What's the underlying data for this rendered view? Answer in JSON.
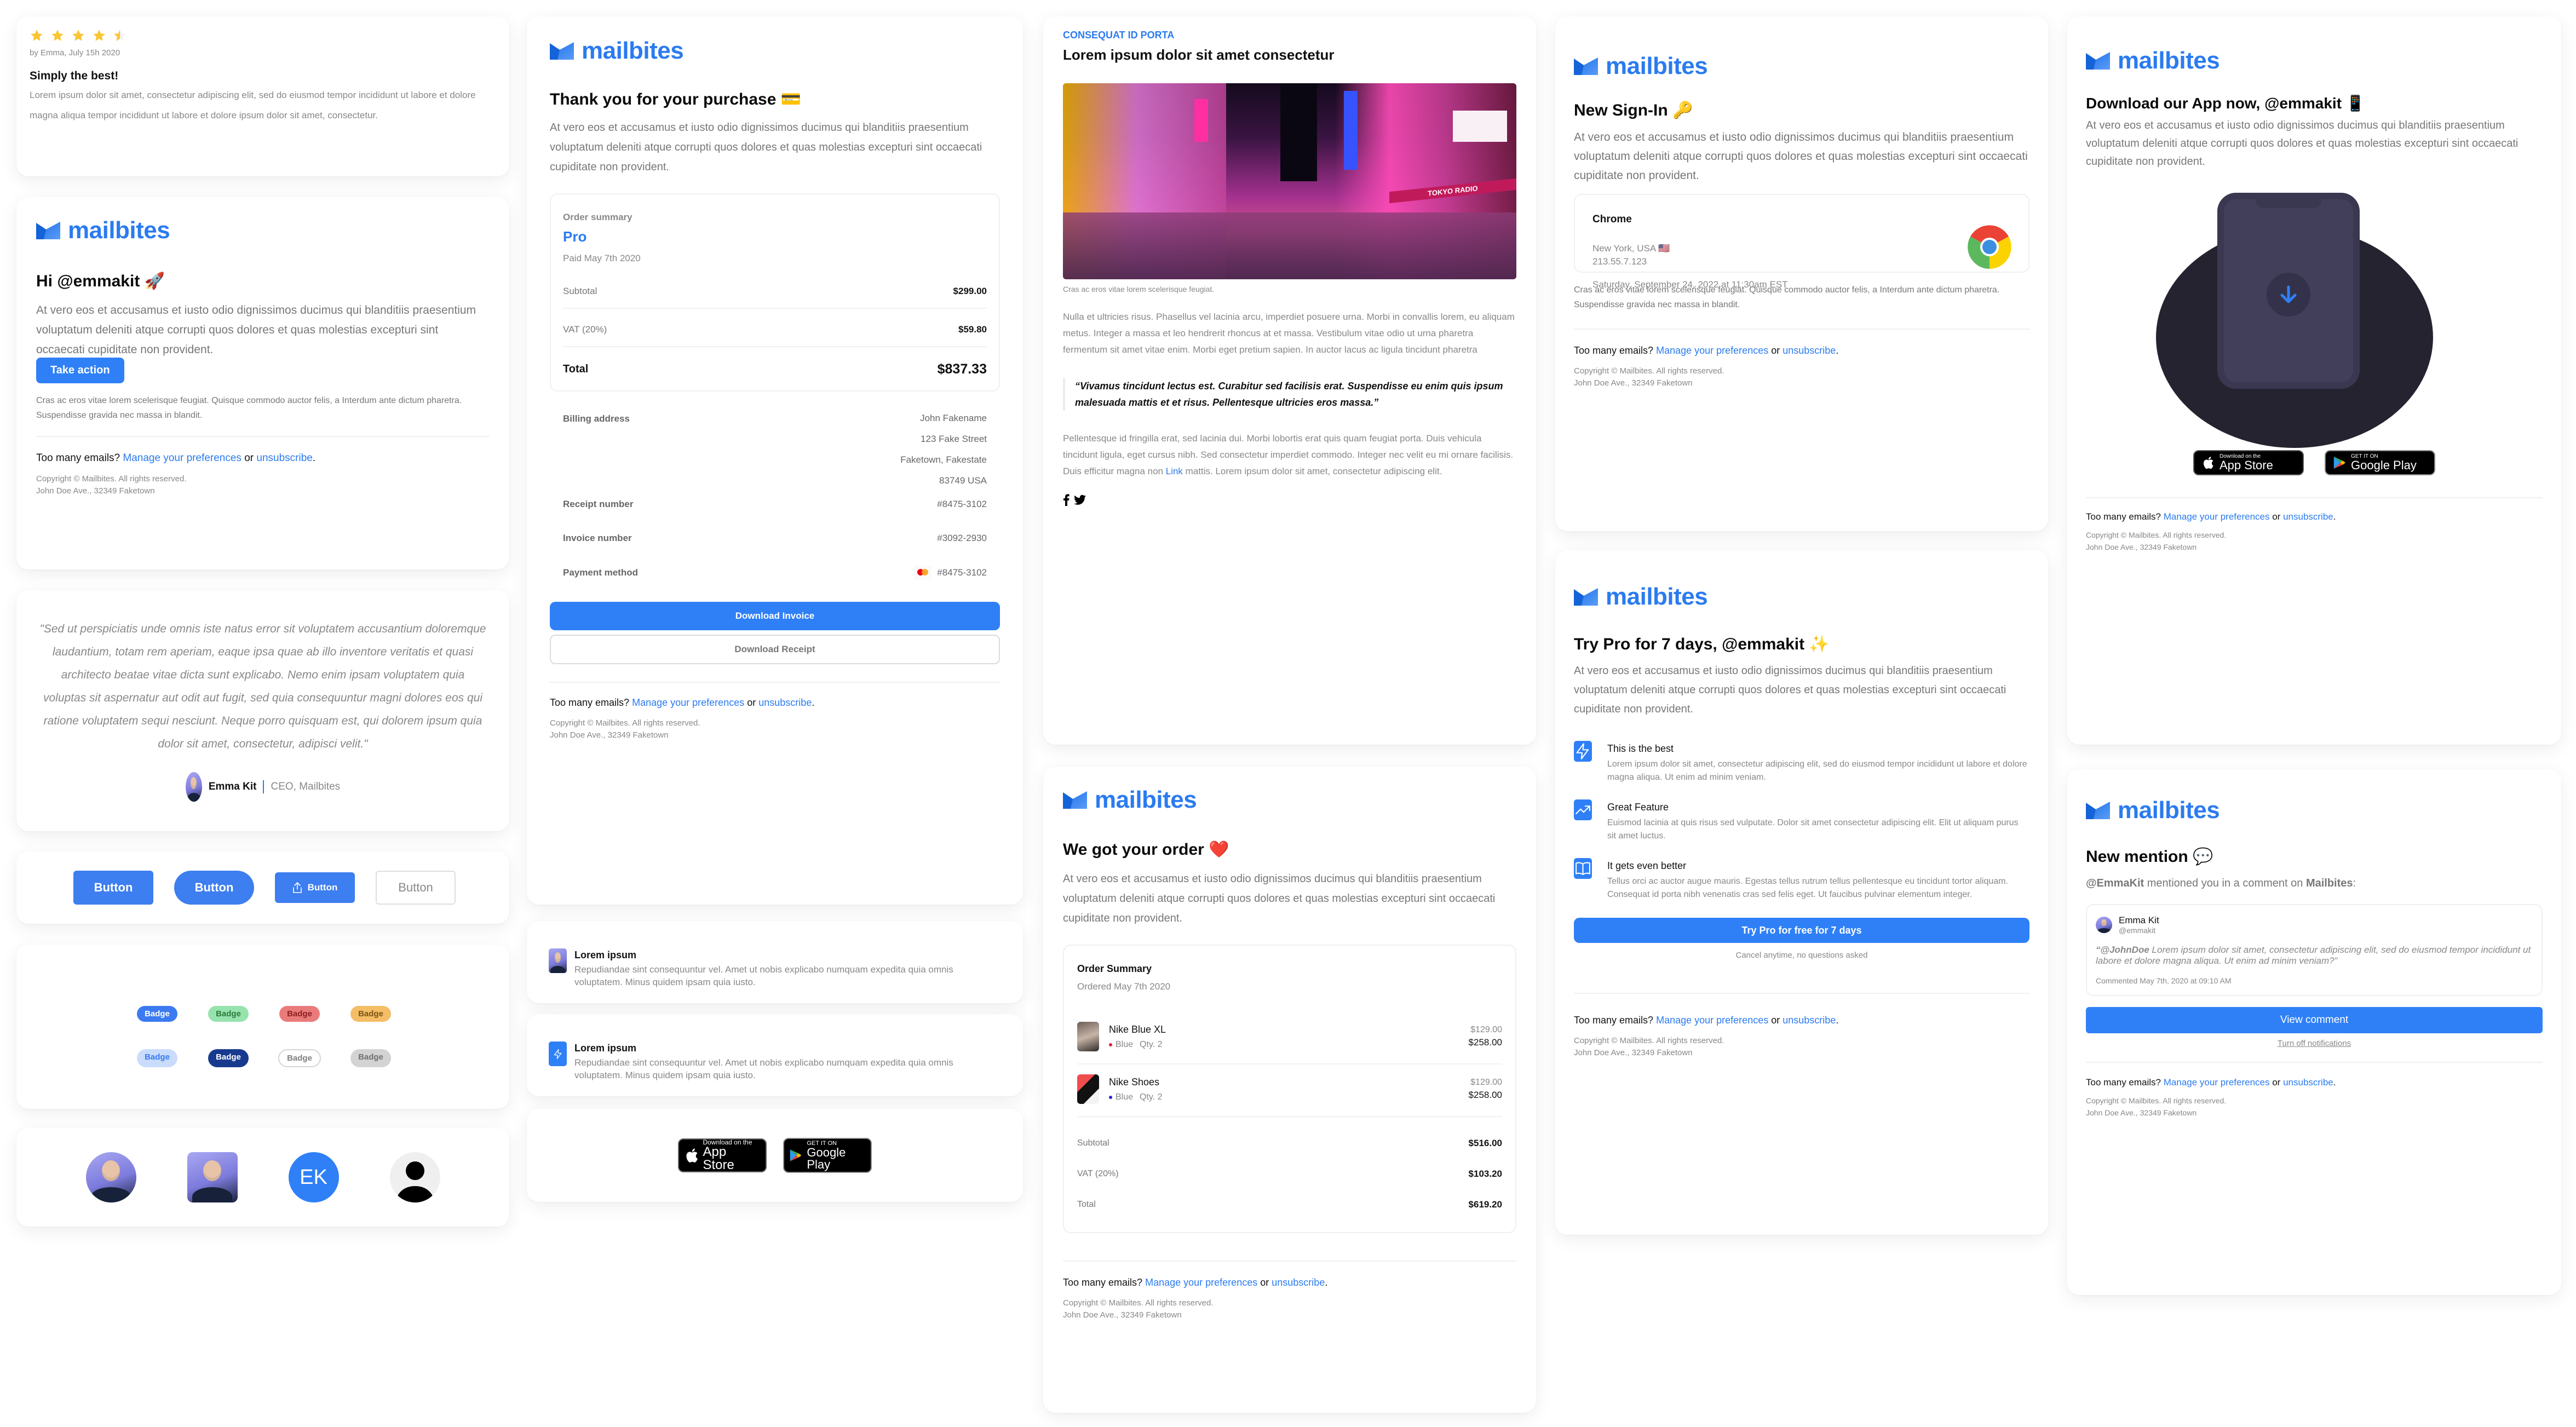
{
  "brand": {
    "name": "mailbites",
    "color": "#2b7bf0"
  },
  "footer": {
    "prefix": "Too many emails?",
    "manage": "Manage your preferences",
    "or": "or",
    "unsubscribe": "unsubscribe",
    "period": ".",
    "copyright": "Copyright © Mailbites. All rights reserved.",
    "address": "John Doe Ave., 32349 Faketown"
  },
  "review": {
    "rating": 4.5,
    "rating_max": 5,
    "byline": "by Emma, July 15h 2020",
    "title": "Simply the best!",
    "body": "Lorem ipsum dolor sit amet, consectetur adipiscing elit, sed do eiusmod tempor incididunt ut labore et dolore magna aliqua tempor incididunt ut labore et dolore ipsum dolor sit amet, consectetur."
  },
  "welcome": {
    "title": "Hi @emmakit 🚀",
    "lead": "At vero eos et accusamus et iusto odio dignissimos ducimus qui blanditiis praesentium voluptatum deleniti atque corrupti quos dolores et quas molestias excepturi sint occaecati cupiditate non provident.",
    "cta": "Take action",
    "note": "Cras ac eros vitae lorem scelerisque feugiat. Quisque commodo auctor felis, a Interdum ante dictum pharetra. Suspendisse gravida nec massa in blandit."
  },
  "testimonial": {
    "quote": "\"Sed ut perspiciatis unde omnis iste natus error sit voluptatem accusantium doloremque laudantium, totam rem aperiam, eaque ipsa quae ab illo inventore veritatis et quasi architecto beatae vitae dicta sunt explicabo. Nemo enim ipsam voluptatem quia voluptas sit aspernatur aut odit aut fugit, sed quia consequuntur magni dolores eos qui ratione voluptatem sequi nesciunt. Neque porro quisquam est, qui dolorem ipsum quia dolor sit amet, consectetur, adipisci velit.\"",
    "name": "Emma Kit",
    "role": "CEO, Mailbites"
  },
  "buttons": {
    "items": [
      {
        "label": "Button",
        "style": "square"
      },
      {
        "label": "Button",
        "style": "pill"
      },
      {
        "label": "Button",
        "style": "icon",
        "icon": "share-icon"
      },
      {
        "label": "Button",
        "style": "outline"
      }
    ]
  },
  "badges": {
    "items": [
      {
        "label": "Badge",
        "bg": "#3b7af0",
        "fg": "#ffffff"
      },
      {
        "label": "Badge",
        "bg": "#97e3ad",
        "fg": "#2a7a3e"
      },
      {
        "label": "Badge",
        "bg": "#ea7b7b",
        "fg": "#8b1f1f"
      },
      {
        "label": "Badge",
        "bg": "#f4bd66",
        "fg": "#7a5516"
      },
      {
        "label": "Badge",
        "bg": "#c9dcfb",
        "fg": "#3b7af0"
      },
      {
        "label": "Badge",
        "bg": "#173a8f",
        "fg": "#ffffff"
      },
      {
        "label": "Badge",
        "bg": "#ffffff",
        "fg": "#808080",
        "border": "#d6d6d6"
      },
      {
        "label": "Badge",
        "bg": "#d3d3d3",
        "fg": "#707070"
      }
    ]
  },
  "avatars": {
    "initials": "EK"
  },
  "purchase": {
    "title": "Thank you for your purchase 💳",
    "lead": "At vero eos et accusamus et iusto odio dignissimos ducimus qui blanditiis praesentium voluptatum deleniti atque corrupti quos dolores et quas molestias excepturi sint occaecati cupiditate non provident.",
    "summary_label": "Order summary",
    "plan": "Pro",
    "paid": "Paid May 7th 2020",
    "lines": [
      {
        "label": "Subtotal",
        "value": "$299.00"
      },
      {
        "label": "VAT (20%)",
        "value": "$59.80"
      }
    ],
    "total_label": "Total",
    "total_value": "$837.33",
    "billing_label": "Billing address",
    "billing_lines": [
      "John Fakename",
      "123 Fake Street",
      "Faketown, Fakestate",
      "83749 USA"
    ],
    "receipt_label": "Receipt number",
    "receipt_value": "#8475-3102",
    "invoice_label": "Invoice number",
    "invoice_value": "#3092-2930",
    "payment_label": "Payment method",
    "payment_value": "#8475-3102",
    "download_invoice": "Download Invoice",
    "download_receipt": "Download Receipt"
  },
  "list_items": [
    {
      "title": "Lorem ipsum",
      "body": "Repudiandae sint consequuntur vel. Amet ut nobis explicabo numquam expedita quia omnis voluptatem. Minus quidem ipsam quia iusto.",
      "media": "avatar"
    },
    {
      "title": "Lorem ipsum",
      "body": "Repudiandae sint consequuntur vel. Amet ut nobis explicabo numquam expedita quia omnis voluptatem. Minus quidem ipsam quia iusto.",
      "media": "lightning-icon"
    }
  ],
  "stores": {
    "apple_small": "Download on the",
    "apple_big": "App Store",
    "google_small": "GET IT ON",
    "google_big": "Google Play"
  },
  "article": {
    "eyebrow": "CONSEQUAT ID PORTA",
    "title": "Lorem ipsum dolor sit amet consectetur",
    "caption": "Cras ac eros vitae lorem scelerisque feugiat.",
    "p1": "Nulla et ultricies risus. Phasellus vel lacinia arcu, imperdiet posuere urna. Morbi in convallis lorem, eu aliquam metus. Integer a massa et leo hendrerit rhoncus at et massa. Vestibulum vitae odio ut urna pharetra fermentum sit amet vitae enim. Morbi eget pretium sapien. In auctor lacus ac ligula tincidunt pharetra",
    "quote": "“Vivamus tincidunt lectus est. Curabitur sed facilisis erat. Suspendisse eu enim quis ipsum malesuada mattis et et risus. Pellentesque ultricies eros massa.”",
    "p2_before": "Pellentesque id fringilla erat, sed lacinia dui. Morbi lobortis erat quis quam feugiat porta. Duis vehicula tincidunt ligula, eget cursus nibh. Sed consectetur imperdiet commodo. Integer nec velit eu mi ornare facilisis. Duis efficitur magna non",
    "p2_link": "Link",
    "p2_after": "mattis. Lorem ipsum dolor sit amet, consectetur adipiscing elit.",
    "image_sign": "TOKYO RADIO"
  },
  "order": {
    "title": "We got your order ❤️",
    "lead": "At vero eos et accusamus et iusto odio dignissimos ducimus qui blanditiis praesentium voluptatum deleniti atque corrupti quos dolores et quas molestias excepturi sint occaecati cupiditate non provident.",
    "summary_title": "Order Summary",
    "ordered": "Ordered May 7th 2020",
    "items": [
      {
        "name": "Nike Blue XL",
        "color_label": "Blue",
        "dot": "#e0202e",
        "qty": "Qty. 2",
        "unit": "$129.00",
        "total": "$258.00"
      },
      {
        "name": "Nike Shoes",
        "color_label": "Blue",
        "dot": "#2a1ee0",
        "qty": "Qty. 2",
        "unit": "$129.00",
        "total": "$258.00"
      }
    ],
    "lines": [
      {
        "label": "Subtotal",
        "value": "$516.00"
      },
      {
        "label": "VAT (20%)",
        "value": "$103.20"
      },
      {
        "label": "Total",
        "value": "$619.20"
      }
    ]
  },
  "signin": {
    "title": "New Sign-In 🔑",
    "lead": "At vero eos et accusamus et iusto odio dignissimos ducimus qui blanditiis praesentium voluptatum deleniti atque corrupti quos dolores et quas molestias excepturi sint occaecati cupiditate non provident.",
    "browser": "Chrome",
    "location": "New York, USA 🇺🇸",
    "ip": "213.55.7.123",
    "datetime": "Saturday, September 24, 2022 at 11:30am EST",
    "note": "Cras ac eros vitae lorem scelerisque feugiat. Quisque commodo auctor felis, a Interdum ante dictum pharetra. Suspendisse gravida nec massa in blandit."
  },
  "trial": {
    "title": "Try Pro for 7 days, @emmakit ✨",
    "lead": "At vero eos et accusamus et iusto odio dignissimos ducimus qui blanditiis praesentium voluptatum deleniti atque corrupti quos dolores et quas molestias excepturi sint occaecati cupiditate non provident.",
    "features": [
      {
        "icon": "lightning-icon",
        "title": "This is the best",
        "body": "Lorem ipsum dolor sit amet, consectetur adipiscing elit, sed do eiusmod tempor incididunt ut labore et dolore magna aliqua. Ut enim ad minim veniam."
      },
      {
        "icon": "trending-up-icon",
        "title": "Great Feature",
        "body": "Euismod lacinia at quis risus sed vulputate. Dolor sit amet consectetur adipiscing elit. Elit ut aliquam purus sit amet luctus."
      },
      {
        "icon": "book-icon",
        "title": "It gets even better",
        "body": "Tellus orci ac auctor augue mauris. Egestas tellus rutrum tellus pellentesque eu tincidunt tortor aliquam. Consequat id porta nibh venenatis cras sed felis eget. Ut faucibus pulvinar elementum integer."
      }
    ],
    "cta": "Try Pro for free for 7 days",
    "note": "Cancel anytime, no questions asked"
  },
  "app": {
    "title": "Download our App now, @emmakit 📱",
    "lead": "At vero eos et accusamus et iusto odio dignissimos ducimus qui blanditiis praesentium voluptatum deleniti atque corrupti quos dolores et quas molestias excepturi sint occaecati cupiditate non provident."
  },
  "mention": {
    "title": "New mention 💬",
    "actor": "@EmmaKit",
    "middle": "mentioned you in a comment on",
    "target": "Mailbites",
    "colon": ":",
    "author_name": "Emma Kit",
    "author_handle": "@emmakit",
    "quote_mention": "“@JohnDoe",
    "quote_body": "Lorem ipsum dolor sit amet, consectetur adipiscing elit, sed do eiusmod tempor incididunt ut labore et dolore magna aliqua. Ut enim ad minim veniam?”",
    "timestamp": "Commented May 7th, 2020 at 09:10 AM",
    "cta": "View comment",
    "turn_off": "Turn off notifications"
  }
}
